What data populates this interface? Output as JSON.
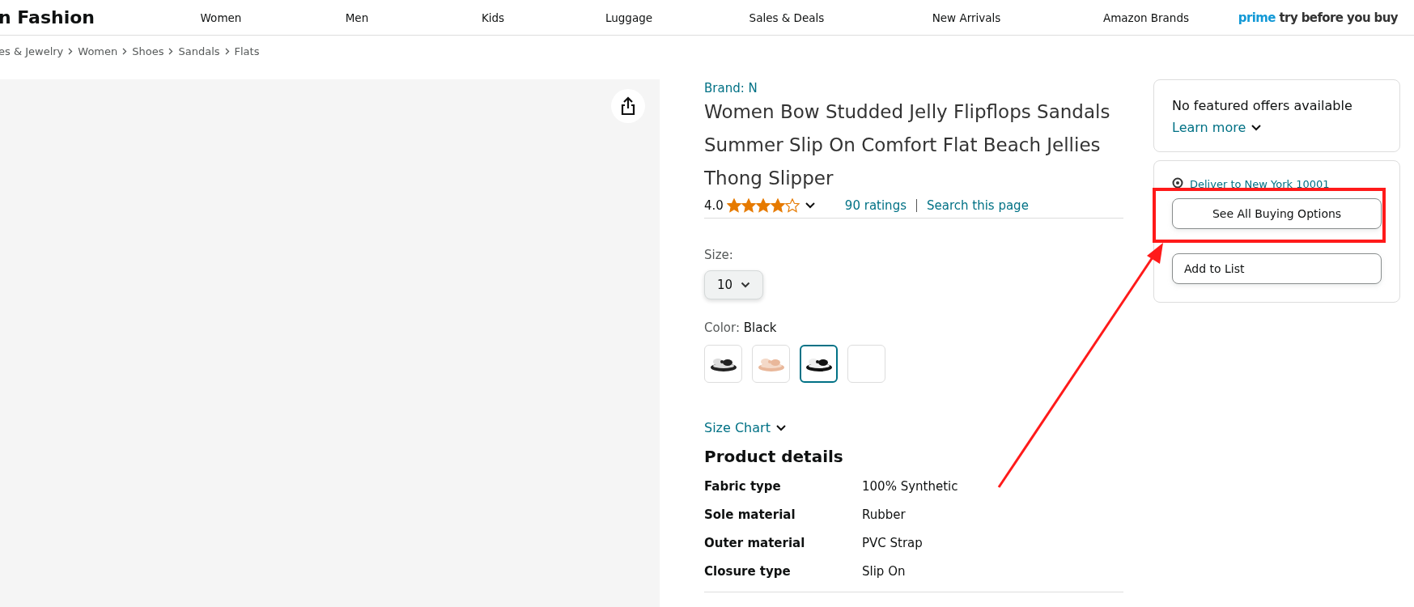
{
  "header": {
    "logo": "n Fashion",
    "nav": [
      "Women",
      "Men",
      "Kids",
      "Luggage",
      "Sales & Deals",
      "New Arrivals",
      "Amazon Brands"
    ],
    "prime_word": "prime",
    "prime_tagline": "try before you buy"
  },
  "breadcrumb": [
    "es & Jewelry",
    "Women",
    "Shoes",
    "Sandals",
    "Flats"
  ],
  "product": {
    "brand": "Brand: N",
    "title": "Women Bow Studded Jelly Flipflops Sandals Summer Slip On Comfort Flat Beach Jellies Thong Slipper",
    "rating": "4.0",
    "stars": 4,
    "ratings_link": "90 ratings",
    "search_link": "Search this page",
    "size_label": "Size:",
    "size_value": "10",
    "color_label": "Color: ",
    "color_value": "Black",
    "swatches": [
      {
        "kind": "picture",
        "selected": false
      },
      {
        "kind": "picture",
        "selected": false
      },
      {
        "kind": "picture",
        "selected": true
      },
      {
        "kind": "empty",
        "selected": false
      }
    ],
    "size_chart": "Size Chart",
    "details_heading": "Product details",
    "details": [
      {
        "key": "Fabric type",
        "value": "100% Synthetic"
      },
      {
        "key": "Sole material",
        "value": "Rubber"
      },
      {
        "key": "Outer material",
        "value": "PVC Strap"
      },
      {
        "key": "Closure type",
        "value": "Slip On"
      }
    ]
  },
  "offers": {
    "message": "No featured offers available",
    "learn_more": "Learn more",
    "deliver": "Deliver to New York 10001",
    "buttons": [
      "See All Buying Options",
      "Add to List"
    ]
  }
}
